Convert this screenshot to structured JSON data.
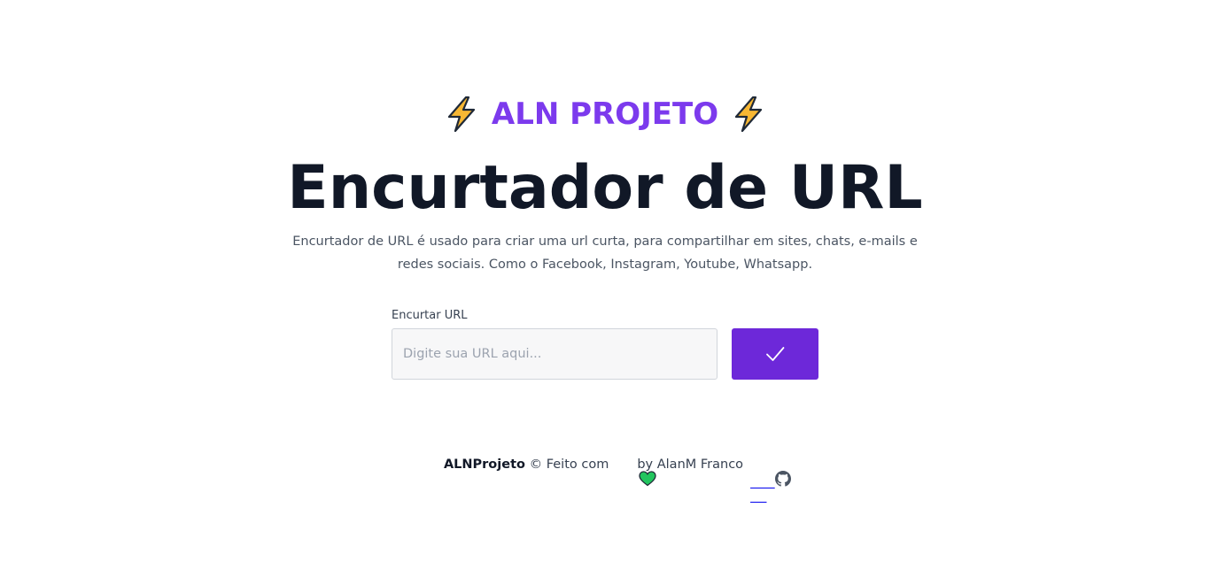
{
  "brand": {
    "name": "ALN PROJETO",
    "left_icon": "lightning-bolt-icon",
    "right_icon": "lightning-bolt-icon",
    "accent_color": "#7c3aed"
  },
  "hero": {
    "title": "Encurtador de URL",
    "description": "Encurtador de URL é usado para criar uma url curta, para compartilhar em sites, chats, e-mails e redes sociais. Como o Facebook, Instagram, Youtube, Whatsapp."
  },
  "form": {
    "label": "Encurtar URL",
    "input_value": "",
    "input_placeholder": "Digite sua URL aqui...",
    "submit_icon": "checkmark-icon",
    "button_color": "#6d28d9"
  },
  "footer": {
    "project": "ALNProjeto",
    "copyright": " © Feito com",
    "heart_icon": "green-heart-icon",
    "author": "by AlanM Franco",
    "github_icon": "github-icon"
  }
}
